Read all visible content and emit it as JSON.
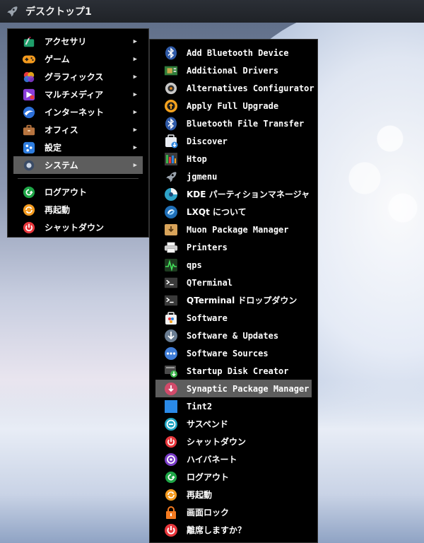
{
  "taskbar": {
    "title": "デスクトップ1",
    "icon": "rocket-icon"
  },
  "main_menu": {
    "items": [
      {
        "label": "アクセサリ",
        "icon": "accessories-icon",
        "has_submenu": true
      },
      {
        "label": "ゲーム",
        "icon": "games-icon",
        "has_submenu": true
      },
      {
        "label": "グラフィックス",
        "icon": "graphics-icon",
        "has_submenu": true
      },
      {
        "label": "マルチメディア",
        "icon": "multimedia-icon",
        "has_submenu": true
      },
      {
        "label": "インターネット",
        "icon": "internet-icon",
        "has_submenu": true
      },
      {
        "label": "オフィス",
        "icon": "office-icon",
        "has_submenu": true
      },
      {
        "label": "設定",
        "icon": "settings-icon",
        "has_submenu": true
      },
      {
        "label": "システム",
        "icon": "system-icon",
        "has_submenu": true,
        "selected": true
      }
    ],
    "session_items": [
      {
        "label": "ログアウト",
        "icon": "logout-icon"
      },
      {
        "label": "再起動",
        "icon": "reboot-icon"
      },
      {
        "label": "シャットダウン",
        "icon": "shutdown-icon"
      }
    ],
    "submenu_arrow": "▶"
  },
  "system_menu": {
    "items": [
      {
        "label": "Add Bluetooth Device",
        "icon": "bluetooth-icon"
      },
      {
        "label": "Additional Drivers",
        "icon": "driver-chip-icon"
      },
      {
        "label": "Alternatives Configurator",
        "icon": "alternatives-icon"
      },
      {
        "label": "Apply Full Upgrade",
        "icon": "upgrade-icon"
      },
      {
        "label": "Bluetooth File Transfer",
        "icon": "bluetooth-icon"
      },
      {
        "label": "Discover",
        "icon": "discover-icon"
      },
      {
        "label": "Htop",
        "icon": "htop-icon"
      },
      {
        "label": "jgmenu",
        "icon": "rocket-icon"
      },
      {
        "label": "KDE パーティションマネージャ",
        "icon": "partition-icon"
      },
      {
        "label": "LXQt について",
        "icon": "lxqt-icon"
      },
      {
        "label": "Muon Package Manager",
        "icon": "muon-icon"
      },
      {
        "label": "Printers",
        "icon": "printer-icon"
      },
      {
        "label": "qps",
        "icon": "qps-icon"
      },
      {
        "label": "QTerminal",
        "icon": "terminal-icon"
      },
      {
        "label": "QTerminal ドロップダウン",
        "icon": "terminal-icon"
      },
      {
        "label": "Software",
        "icon": "software-store-icon"
      },
      {
        "label": "Software & Updates",
        "icon": "software-updates-icon"
      },
      {
        "label": "Software Sources",
        "icon": "software-sources-icon"
      },
      {
        "label": "Startup Disk Creator",
        "icon": "usb-creator-icon"
      },
      {
        "label": "Synaptic Package Manager",
        "icon": "synaptic-icon",
        "selected": true
      },
      {
        "label": "Tint2",
        "icon": "tint2-icon"
      },
      {
        "label": "サスペンド",
        "icon": "suspend-icon"
      },
      {
        "label": "シャットダウン",
        "icon": "shutdown-icon"
      },
      {
        "label": "ハイバネート",
        "icon": "hibernate-icon"
      },
      {
        "label": "ログアウト",
        "icon": "logout-icon"
      },
      {
        "label": "再起動",
        "icon": "reboot-icon"
      },
      {
        "label": "画面ロック",
        "icon": "lock-icon"
      },
      {
        "label": "離席しますか？",
        "icon": "away-icon"
      }
    ]
  },
  "colors": {
    "menu_bg": "#000000",
    "highlight": "#5d5d5d",
    "text": "#ffffff"
  }
}
